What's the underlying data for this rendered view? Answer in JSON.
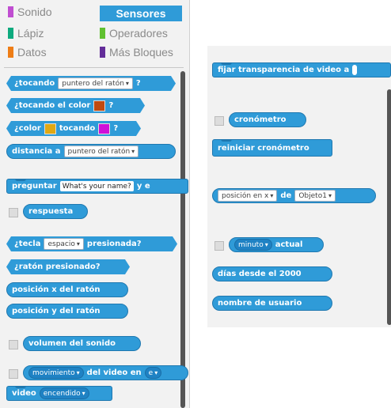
{
  "categories": {
    "sonido": {
      "label": "Sonido",
      "color": "#c04ed1"
    },
    "sensores": {
      "label": "Sensores"
    },
    "lapiz": {
      "label": "Lápiz",
      "color": "#0eaa7e"
    },
    "operadores": {
      "label": "Operadores",
      "color": "#60c030"
    },
    "datos": {
      "label": "Datos",
      "color": "#ee7d16"
    },
    "mas": {
      "label": "Más Bloques",
      "color": "#632d99"
    }
  },
  "left": {
    "tocando": {
      "text": "¿tocando",
      "dd": "puntero del ratón",
      "q": "?"
    },
    "tocando_color": {
      "text": "¿tocando el color",
      "q": "?",
      "color": "#c04a10"
    },
    "color_tocando": {
      "text": "¿color",
      "mid": "tocando",
      "q": "?",
      "c1": "#e0a814",
      "c2": "#d010d8"
    },
    "distancia": {
      "text": "distancia a",
      "dd": "puntero del ratón"
    },
    "preguntar": {
      "text": "preguntar",
      "input": "What's your name?",
      "tail": "y e"
    },
    "respuesta": {
      "text": "respuesta"
    },
    "tecla": {
      "text": "¿tecla",
      "dd": "espacio",
      "tail": "presionada?"
    },
    "raton": {
      "text": "¿ratón presionado?"
    },
    "posx": {
      "text": "posición x del ratón"
    },
    "posy": {
      "text": "posición y del ratón"
    },
    "volumen": {
      "text": "volumen del sonido"
    },
    "movimiento": {
      "dd": "movimiento",
      "text": "del video en",
      "tail": "e"
    },
    "video": {
      "text": "video",
      "dd": "encendido"
    }
  },
  "right": {
    "transparencia": {
      "text": "fijar transparencia de video a"
    },
    "cronometro": {
      "text": "cronómetro"
    },
    "reiniciar": {
      "text": "reiniciar cronómetro"
    },
    "posicion": {
      "dd1": "posición en x",
      "text": "de",
      "dd2": "Objeto1"
    },
    "actual": {
      "dd": "minuto",
      "text": "actual"
    },
    "dias": {
      "text": "días desde el 2000"
    },
    "usuario": {
      "text": "nombre de usuario"
    }
  }
}
